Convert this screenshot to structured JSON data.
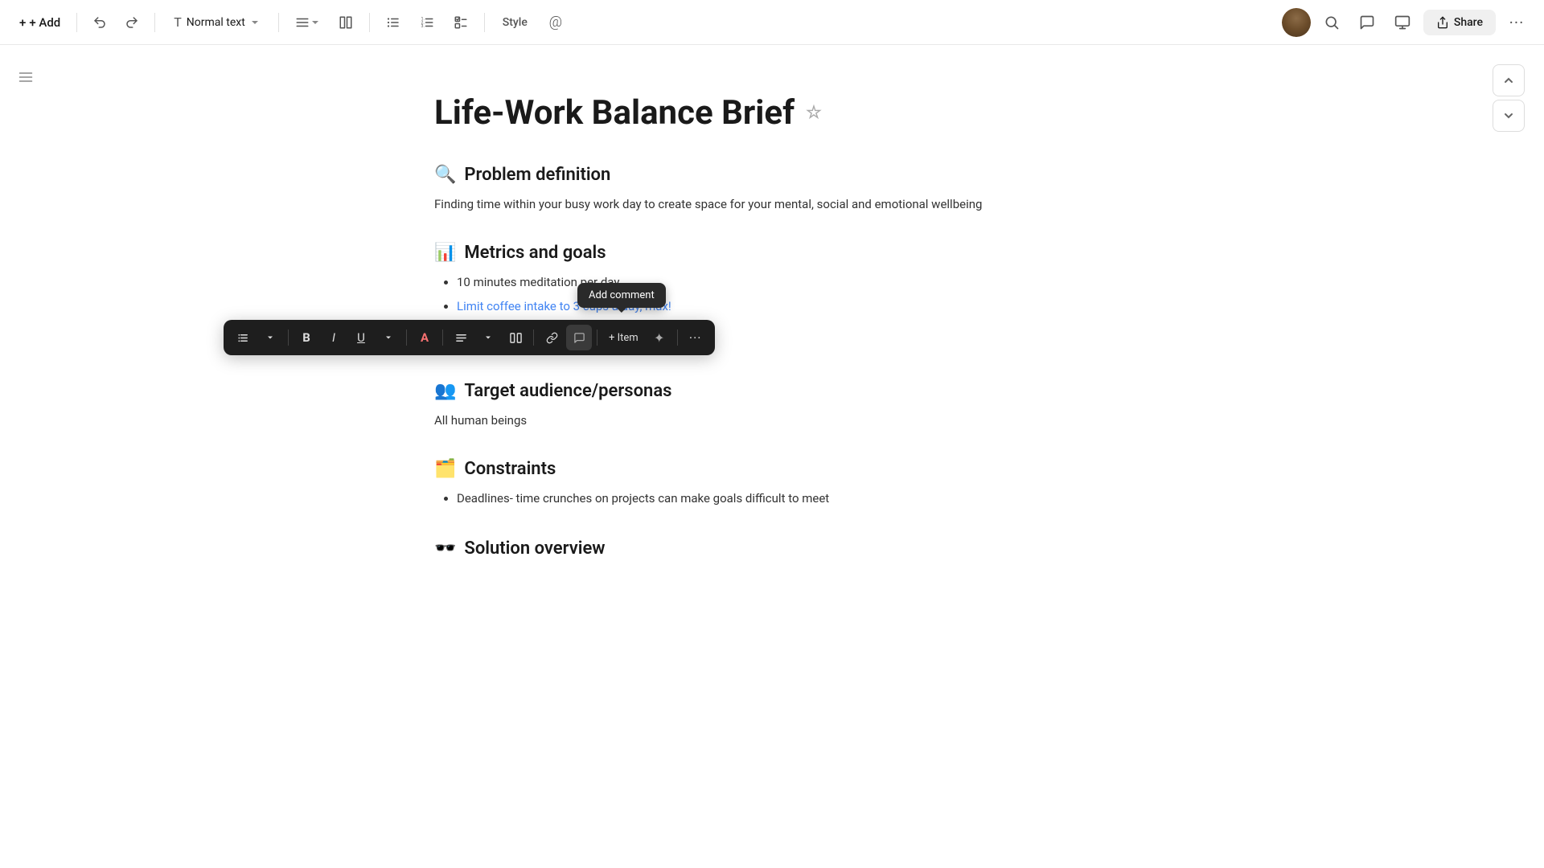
{
  "toolbar": {
    "add_label": "+ Add",
    "text_type": "Normal text",
    "style_label": "Style",
    "at_label": "@",
    "share_label": "Share"
  },
  "document": {
    "title": "Life-Work Balance Brief",
    "sections": [
      {
        "id": "problem",
        "icon": "🔍",
        "heading": "Problem definition",
        "body": "Finding time within your busy work day to create space for your mental, social and emotional wellbeing",
        "bullets": []
      },
      {
        "id": "metrics",
        "icon": "📊",
        "heading": "Metrics and goals",
        "body": "",
        "bullets": [
          "10 minutes meditation per day",
          "Limit coffee intake to 3 cups a day, max!"
        ],
        "highlighted_bullet": 1
      },
      {
        "id": "audience",
        "icon": "👥",
        "heading": "Target audience/personas",
        "body": "All human beings",
        "bullets": []
      },
      {
        "id": "constraints",
        "icon": "🗂️",
        "heading": "Constraints",
        "body": "",
        "bullets": [
          "Deadlines- time crunches on projects can make goals difficult to meet"
        ]
      },
      {
        "id": "solution",
        "icon": "🕶️",
        "heading": "Solution overview",
        "body": "",
        "bullets": []
      }
    ]
  },
  "floating_toolbar": {
    "list_icon": "☰",
    "bold_label": "B",
    "italic_label": "I",
    "underline_label": "U",
    "color_label": "A",
    "align_label": "≡",
    "columns_label": "⊞",
    "link_label": "🔗",
    "comment_label": "💬",
    "item_label": "+ Item",
    "ai_label": "✦",
    "more_label": "···"
  },
  "tooltip": {
    "add_comment": "Add comment"
  },
  "nav": {
    "up_label": "▲",
    "down_label": "▼"
  }
}
